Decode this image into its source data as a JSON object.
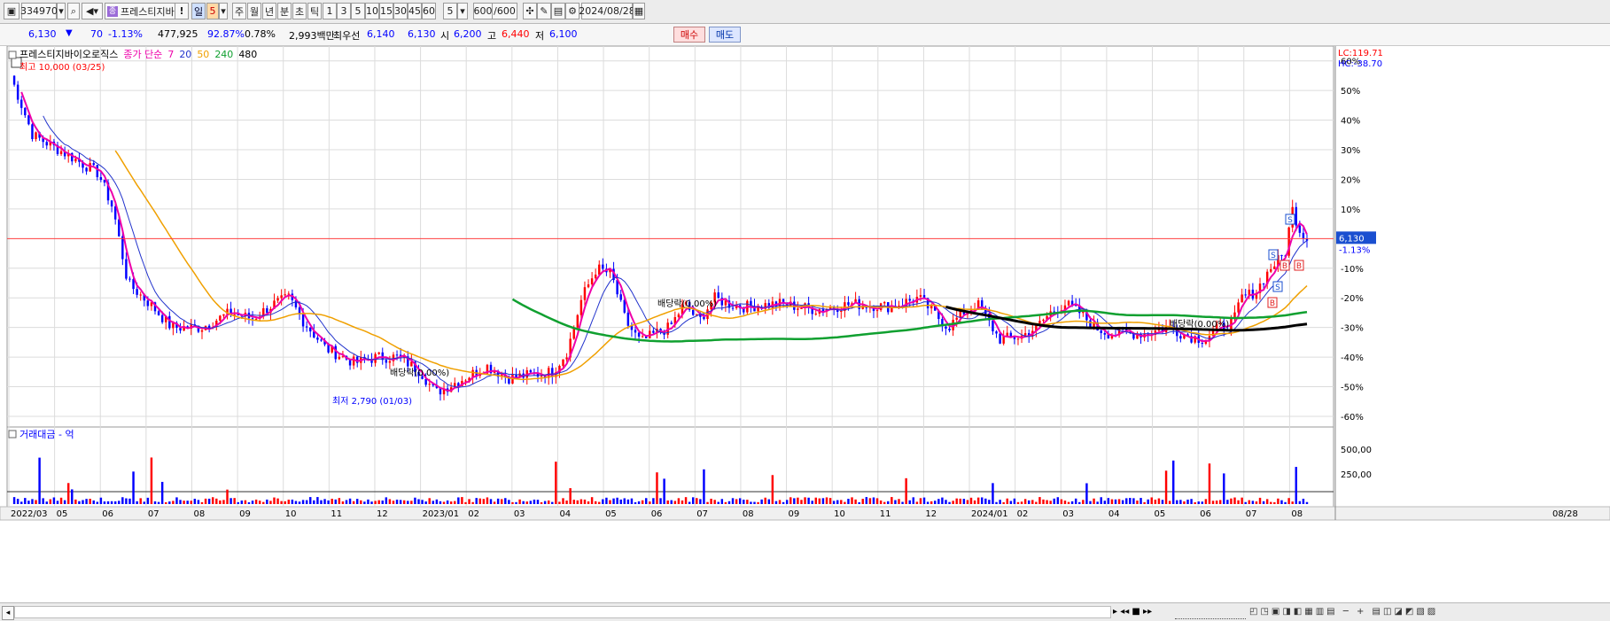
{
  "toolbar": {
    "code": "334970",
    "name": "프레스티지바",
    "badge": "!",
    "day": "일",
    "period_value": "5",
    "period_buttons": [
      "주",
      "월",
      "년",
      "분",
      "초",
      "틱"
    ],
    "interval_buttons": [
      "1",
      "3",
      "5",
      "10",
      "15",
      "30",
      "45",
      "60"
    ],
    "interval_value": "5",
    "count": "600",
    "count_total": "/600",
    "date": "2024/08/28"
  },
  "quote": {
    "price": "6,130",
    "change": "70",
    "change_pct": "-1.13%",
    "volume": "477,925",
    "volume_ratio": "92.87%",
    "turnover": "0.78%",
    "amount": "2,993백만",
    "best_label": "최우선",
    "ask": "6,140",
    "bid": "6,130",
    "open_label": "시",
    "open": "6,200",
    "high_label": "고",
    "high": "6,440",
    "low_label": "저",
    "low": "6,100",
    "buy_label": "매수",
    "sell_label": "매도"
  },
  "legend": {
    "name": "프레스티지바이오로직스",
    "ma_label": "종가 단순",
    "ma7": "7",
    "ma20": "20",
    "ma50": "50",
    "ma240": "240",
    "ma480": "480"
  },
  "colors": {
    "up": "#ff0000",
    "down": "#0000ff",
    "ma7": "#ee00aa",
    "ma20": "#2233cc",
    "ma50": "#f0a000",
    "ma240": "#10a030",
    "ma480": "#000000",
    "current_line": "#ff4040",
    "grid": "#dcdcdc"
  },
  "chart_data": {
    "type": "candlestick",
    "title": "프레스티지바이오로직스",
    "x_labels": [
      "2022/03",
      "05",
      "06",
      "07",
      "08",
      "09",
      "10",
      "11",
      "12",
      "2023/01",
      "02",
      "03",
      "04",
      "05",
      "06",
      "07",
      "08",
      "09",
      "10",
      "11",
      "12",
      "2024/01",
      "02",
      "03",
      "04",
      "05",
      "06",
      "07",
      "08"
    ],
    "x_right_label": "08/28",
    "y_axis_pct_ticks": [
      "60%",
      "50%",
      "40%",
      "30%",
      "20%",
      "10%",
      "-10%",
      "-20%",
      "-30%",
      "-40%",
      "-50%",
      "-60%"
    ],
    "y_range_pct": [
      -63,
      62
    ],
    "corner_labels": {
      "lc": "LC:119.71",
      "hc": "HC:-38.70"
    },
    "current_price_label": "6,130",
    "current_change_label": "-1.13%",
    "current_price_pct": 0,
    "annotations": {
      "high": "최고 10,000 (03/25)",
      "low": "최저 2,790 (01/03)",
      "dividend1": "배당락(0.00%)",
      "dividend2": "배당락(0.00%)",
      "dividend3": "배당락(0.00%)"
    },
    "price_path_pct": [
      [
        0,
        55
      ],
      [
        3,
        35
      ],
      [
        8,
        28
      ],
      [
        12,
        22
      ],
      [
        14,
        10
      ],
      [
        16,
        -15
      ],
      [
        19,
        -22
      ],
      [
        22,
        -30
      ],
      [
        26,
        -30
      ],
      [
        30,
        -25
      ],
      [
        33,
        -27
      ],
      [
        36,
        -22
      ],
      [
        38,
        -20
      ],
      [
        40,
        -28
      ],
      [
        43,
        -37
      ],
      [
        47,
        -42
      ],
      [
        50,
        -40
      ],
      [
        53,
        -40
      ],
      [
        56,
        -45
      ],
      [
        58,
        -52
      ],
      [
        62,
        -47
      ],
      [
        65,
        -43
      ],
      [
        68,
        -47
      ],
      [
        71,
        -46
      ],
      [
        74,
        -45
      ],
      [
        76,
        -38
      ],
      [
        78,
        -20
      ],
      [
        80,
        -10
      ],
      [
        82,
        -12
      ],
      [
        84,
        -28
      ],
      [
        86,
        -35
      ],
      [
        88,
        -32
      ],
      [
        90,
        -30
      ],
      [
        92,
        -22
      ],
      [
        94,
        -28
      ],
      [
        96,
        -20
      ],
      [
        98,
        -22
      ],
      [
        100,
        -23
      ],
      [
        105,
        -22
      ],
      [
        110,
        -24
      ],
      [
        115,
        -22
      ],
      [
        120,
        -23
      ],
      [
        124,
        -20
      ],
      [
        126,
        -25
      ],
      [
        128,
        -30
      ],
      [
        130,
        -25
      ],
      [
        132,
        -22
      ],
      [
        135,
        -34
      ],
      [
        138,
        -33
      ],
      [
        140,
        -30
      ],
      [
        142,
        -25
      ],
      [
        144,
        -22
      ],
      [
        146,
        -25
      ],
      [
        148,
        -30
      ],
      [
        150,
        -32
      ],
      [
        155,
        -32
      ],
      [
        158,
        -30
      ],
      [
        161,
        -33
      ],
      [
        163,
        -34
      ],
      [
        165,
        -30
      ],
      [
        167,
        -28
      ],
      [
        168,
        -20
      ],
      [
        170,
        -18
      ],
      [
        172,
        -10
      ],
      [
        174,
        -5
      ],
      [
        175,
        10
      ],
      [
        176,
        3
      ],
      [
        177,
        0
      ]
    ],
    "volume_label": "거래대금 - 억",
    "volume_ticks": [
      "500,00",
      "250,00"
    ]
  }
}
